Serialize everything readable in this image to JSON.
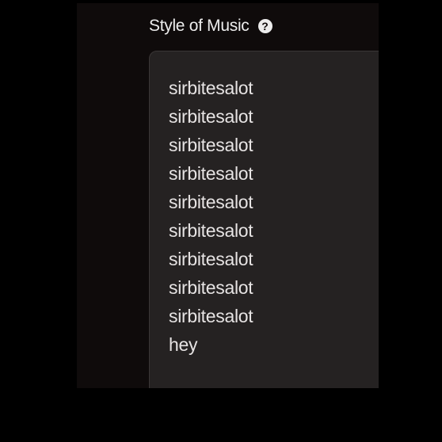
{
  "field": {
    "label": "Style of Music",
    "help_icon": "question-circle-icon",
    "lines": [
      "sirbitesalot",
      "sirbitesalot",
      "sirbitesalot",
      "sirbitesalot",
      "sirbitesalot",
      "sirbitesalot",
      "sirbitesalot",
      "sirbitesalot",
      "sirbitesalot",
      "hey"
    ]
  },
  "colors": {
    "page_background": "#000000",
    "panel_background": "#0f0b0b",
    "textarea_background": "#252222",
    "text": "#e6e3e3"
  }
}
